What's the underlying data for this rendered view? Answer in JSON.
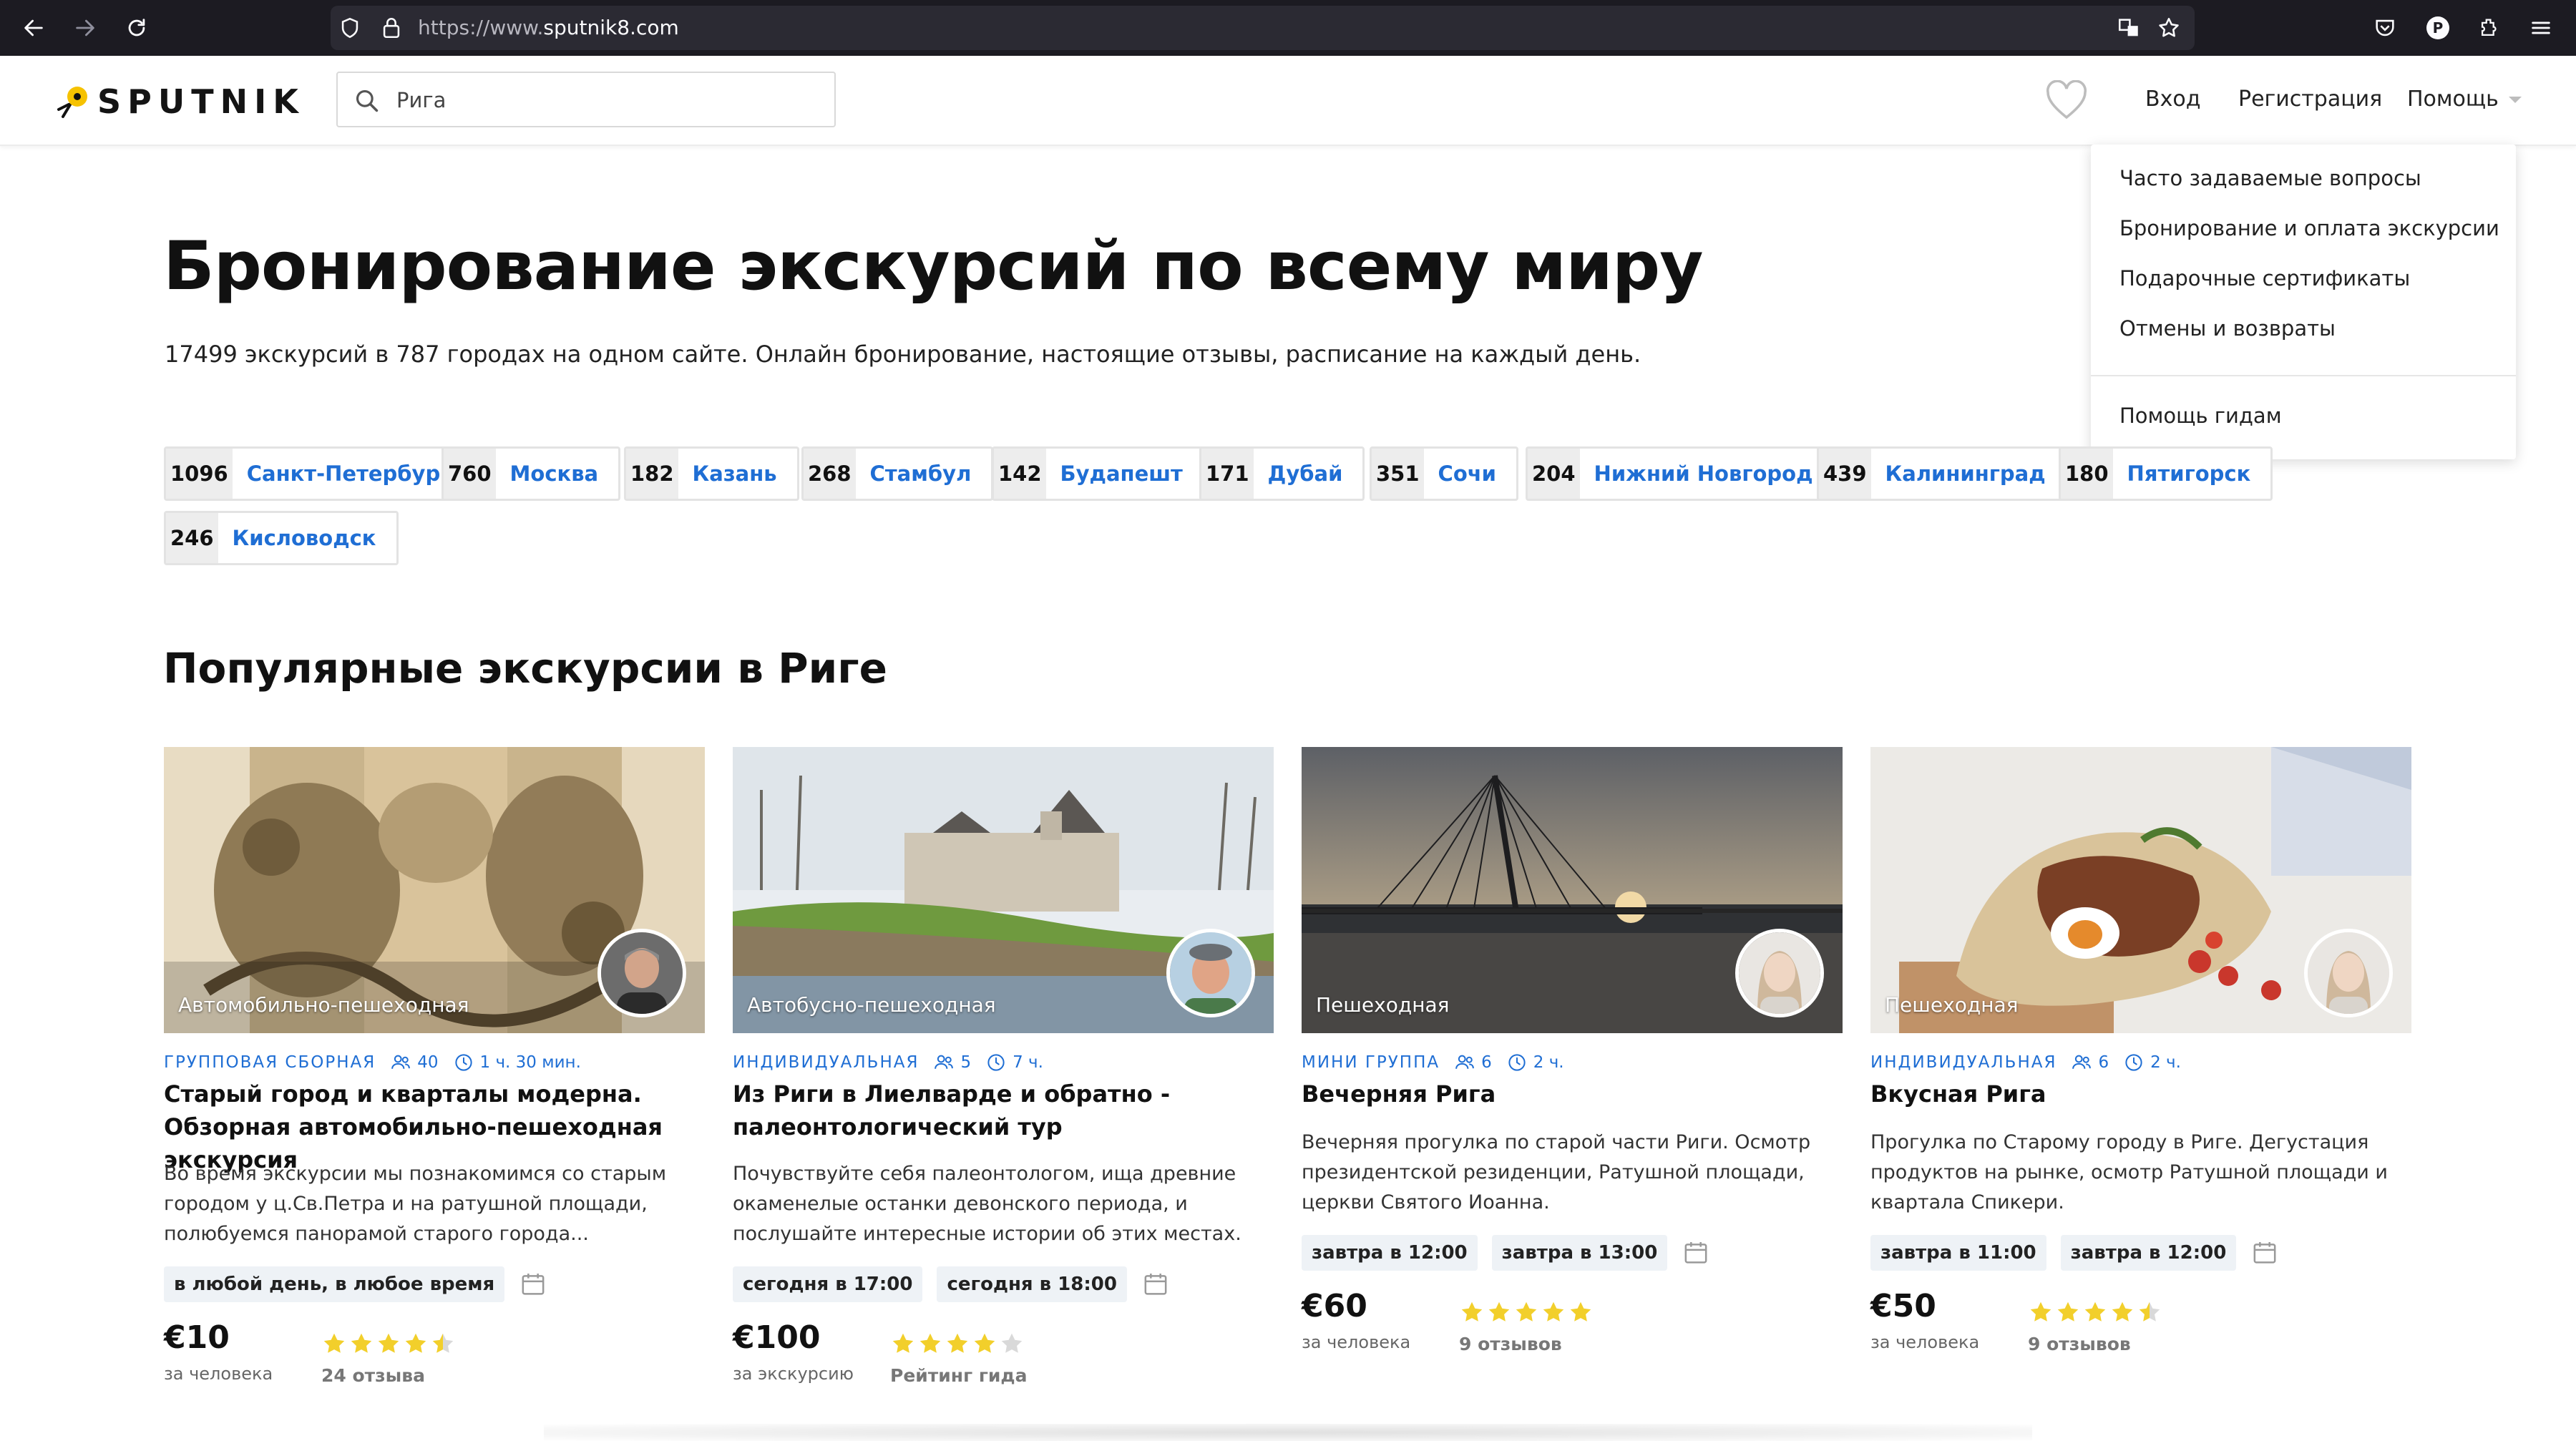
{
  "browser": {
    "url_scheme": "https://www.",
    "url_host": "sputnik8.com",
    "profile_initial": "P"
  },
  "site": {
    "logo_text": "SPUTNIK",
    "search_value": "Рига",
    "nav": {
      "login": "Вход",
      "register": "Регистрация",
      "help": "Помощь"
    },
    "accent_color": "#1f6ed4",
    "help_menu": {
      "items": [
        "Часто задаваемые вопросы",
        "Бронирование и оплата экскурсии",
        "Подарочные сертификаты",
        "Отмены и возвраты"
      ],
      "footer_item": "Помощь гидам"
    }
  },
  "hero": {
    "title": "Бронирование экскурсий по всему миру",
    "subtitle": "17499 экскурсий в 787 городах на одном сайте. Онлайн бронирование, настоящие отзывы, расписание на каждый день."
  },
  "cities": [
    {
      "count": "1096",
      "name": "Санкт-Петербург"
    },
    {
      "count": "760",
      "name": "Москва"
    },
    {
      "count": "182",
      "name": "Казань"
    },
    {
      "count": "268",
      "name": "Стамбул"
    },
    {
      "count": "142",
      "name": "Будапешт"
    },
    {
      "count": "171",
      "name": "Дубай"
    },
    {
      "count": "351",
      "name": "Сочи"
    },
    {
      "count": "204",
      "name": "Нижний Новгород"
    },
    {
      "count": "439",
      "name": "Калининград"
    },
    {
      "count": "180",
      "name": "Пятигорск"
    },
    {
      "count": "246",
      "name": "Кисловодск"
    }
  ],
  "popular": {
    "title": "Популярные экскурсии в Риге",
    "cards": [
      {
        "type": "Автомобильно-пешеходная",
        "format": "ГРУППОВАЯ СБОРНАЯ",
        "people": "40",
        "duration": "1 ч. 30 мин.",
        "title": "Старый город и кварталы модерна. Обзорная автомобильно-пешеходная экскурсия",
        "description": "Во время экскурсии мы познакомимся со старым городом у ц.Св.Петра и на ратушной площади, полюбуемся панорамой старого города...",
        "dates": [
          "в любой день, в любое время"
        ],
        "price": "€10",
        "price_unit": "за человека",
        "rating": 4.5,
        "rating_text": "24 отзыва"
      },
      {
        "type": "Автобусно-пешеходная",
        "format": "ИНДИВИДУАЛЬНАЯ",
        "people": "5",
        "duration": "7 ч.",
        "title": "Из Риги в Лиелварде и обратно - палеонтологический тур",
        "description": "Почувствуйте себя палеонтологом, ища древние окаменелые останки девонского периода, и послушайте интересные истории об этих местах.",
        "dates": [
          "сегодня в 17:00",
          "сегодня в 18:00"
        ],
        "price": "€100",
        "price_unit": "за экскурсию",
        "rating": 4,
        "rating_text": "Рейтинг гида"
      },
      {
        "type": "Пешеходная",
        "format": "МИНИ ГРУППА",
        "people": "6",
        "duration": "2 ч.",
        "title": "Вечерняя Рига",
        "description": "Вечерняя прогулка по старой части Риги. Осмотр президентской резиденции, Ратушной площади, церкви Святого Иоанна.",
        "dates": [
          "завтра в 12:00",
          "завтра в 13:00"
        ],
        "price": "€60",
        "price_unit": "за человека",
        "rating": 5,
        "rating_text": "9 отзывов"
      },
      {
        "type": "Пешеходная",
        "format": "ИНДИВИДУАЛЬНАЯ",
        "people": "6",
        "duration": "2 ч.",
        "title": "Вкусная Рига",
        "description": "Прогулка по Старому городу в Риге. Дегустация продуктов на рынке, осмотр Ратушной площади и квартала Спикери.",
        "dates": [
          "завтра в 11:00",
          "завтра в 12:00"
        ],
        "price": "€50",
        "price_unit": "за человека",
        "rating": 4.5,
        "rating_text": "9 отзывов"
      }
    ]
  }
}
